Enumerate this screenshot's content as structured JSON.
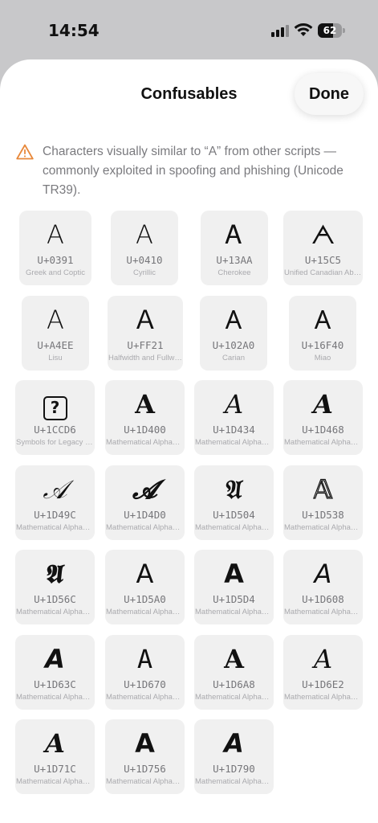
{
  "status_bar": {
    "time": "14:54",
    "battery": "62",
    "battery_level": 0.62
  },
  "sheet": {
    "title": "Confusables",
    "done_label": "Done",
    "warning": "Characters visually similar to “A” from other scripts — commonly exploited in spoofing and phishing (Unicode TR39)."
  },
  "characters": [
    {
      "glyph": "Α",
      "code": "U+0391",
      "script": "Greek and Coptic",
      "style": "g-light"
    },
    {
      "glyph": "А",
      "code": "U+0410",
      "script": "Cyrillic",
      "style": "g-light"
    },
    {
      "glyph": "Ꭺ",
      "code": "U+13AA",
      "script": "Cherokee",
      "style": "g-light"
    },
    {
      "glyph": "ᗅ",
      "code": "U+15C5",
      "script": "Unified Canadian Aboriginal Syllabics",
      "style": "g-light"
    },
    {
      "glyph": "ꓮ",
      "code": "U+A4EE",
      "script": "Lisu",
      "style": "g-light"
    },
    {
      "glyph": "Ａ",
      "code": "U+FF21",
      "script": "Halfwidth and Fullwidth Forms",
      "style": "g-light"
    },
    {
      "glyph": "𐊠",
      "code": "U+102A0",
      "script": "Carian",
      "style": "g-light"
    },
    {
      "glyph": "𖽀",
      "code": "U+16F40",
      "script": "Miao",
      "style": "g-light"
    },
    {
      "glyph": "?",
      "code": "U+1CCD6",
      "script": "Symbols for Legacy Computing Supplement",
      "style": "box"
    },
    {
      "glyph": "𝐀",
      "code": "U+1D400",
      "script": "Mathematical Alphanumeric Symbols",
      "style": "g-serif g-bold"
    },
    {
      "glyph": "𝐴",
      "code": "U+1D434",
      "script": "Mathematical Alphanumeric Symbols",
      "style": "g-serif g-italic"
    },
    {
      "glyph": "𝑨",
      "code": "U+1D468",
      "script": "Mathematical Alphanumeric Symbols",
      "style": "g-serif g-bold g-italic"
    },
    {
      "glyph": "𝒜",
      "code": "U+1D49C",
      "script": "Mathematical Alphanumeric Symbols",
      "style": "g-script"
    },
    {
      "glyph": "𝓐",
      "code": "U+1D4D0",
      "script": "Mathematical Alphanumeric Symbols",
      "style": "g-script g-bold"
    },
    {
      "glyph": "𝔄",
      "code": "U+1D504",
      "script": "Mathematical Alphanumeric Symbols",
      "style": "g-fraktur"
    },
    {
      "glyph": "𝔸",
      "code": "U+1D538",
      "script": "Mathematical Alphanumeric Symbols",
      "style": "g-double"
    },
    {
      "glyph": "𝕬",
      "code": "U+1D56C",
      "script": "Mathematical Alphanumeric Symbols",
      "style": "g-fraktur"
    },
    {
      "glyph": "𝖠",
      "code": "U+1D5A0",
      "script": "Mathematical Alphanumeric Symbols",
      "style": "g-light"
    },
    {
      "glyph": "𝗔",
      "code": "U+1D5D4",
      "script": "Mathematical Alphanumeric Symbols",
      "style": "g-sans g-bold"
    },
    {
      "glyph": "𝘈",
      "code": "U+1D608",
      "script": "Mathematical Alphanumeric Symbols",
      "style": "g-sans g-italic"
    },
    {
      "glyph": "𝘼",
      "code": "U+1D63C",
      "script": "Mathematical Alphanumeric Symbols",
      "style": "g-sans g-bold g-italic"
    },
    {
      "glyph": "𝙰",
      "code": "U+1D670",
      "script": "Mathematical Alphanumeric Symbols",
      "style": "g-mono"
    },
    {
      "glyph": "𝚨",
      "code": "U+1D6A8",
      "script": "Mathematical Alphanumeric Symbols",
      "style": "g-serif g-bold"
    },
    {
      "glyph": "𝛢",
      "code": "U+1D6E2",
      "script": "Mathematical Alphanumeric Symbols",
      "style": "g-serif g-italic"
    },
    {
      "glyph": "𝜜",
      "code": "U+1D71C",
      "script": "Mathematical Alphanumeric Symbols",
      "style": "g-serif g-bold g-italic"
    },
    {
      "glyph": "𝝖",
      "code": "U+1D756",
      "script": "Mathematical Alphanumeric Symbols",
      "style": "g-sans g-bold"
    },
    {
      "glyph": "𝞐",
      "code": "U+1D790",
      "script": "Mathematical Alphanumeric Symbols",
      "style": "g-sans g-bold g-italic"
    }
  ],
  "colors": {
    "warning": "#e8883a",
    "tile": "#f0f0f0",
    "sheet": "#ffffff",
    "backdrop": "#c8c8ca"
  }
}
